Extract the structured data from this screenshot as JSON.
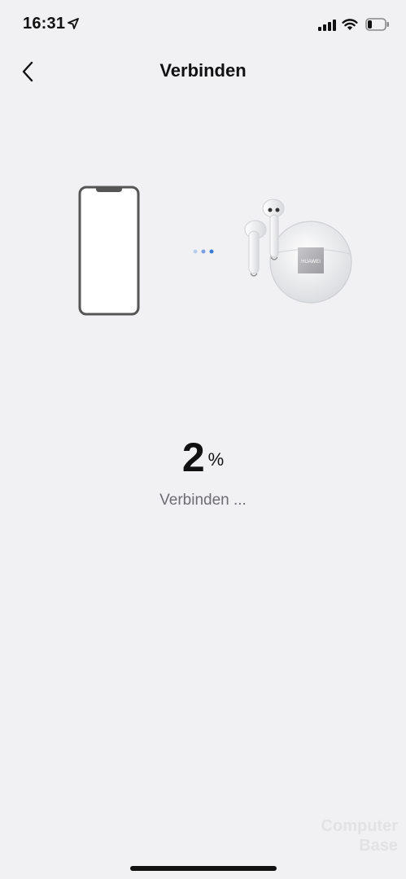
{
  "status_bar": {
    "time": "16:31",
    "icons": [
      "location-arrow-icon",
      "cellular-signal-icon",
      "wifi-icon",
      "battery-icon"
    ],
    "battery_level_fraction": 0.25
  },
  "nav": {
    "title": "Verbinden",
    "back_icon": "chevron-left-icon"
  },
  "illustration": {
    "device_icon": "phone-outline-icon",
    "earbuds_brand": "HUAWEI",
    "connecting_dots": 3
  },
  "progress": {
    "value": "2",
    "unit": "%",
    "status": "Verbinden ..."
  },
  "watermark": {
    "line1": "Computer",
    "line2": "Base"
  },
  "colors": {
    "background": "#f1f1f3",
    "accent": "#3a7bd5",
    "text_primary": "#111111",
    "text_secondary": "#6d6d72"
  }
}
